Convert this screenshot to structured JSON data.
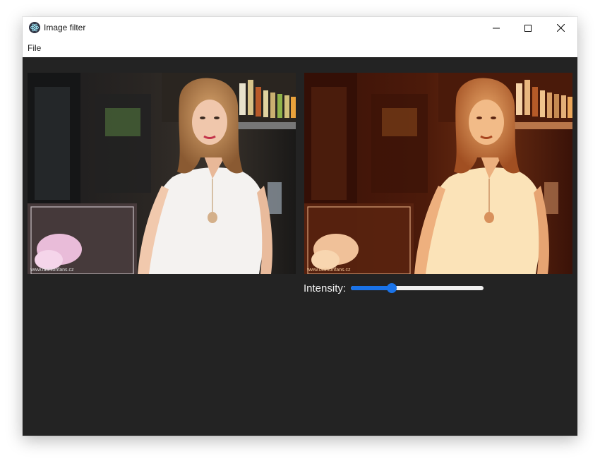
{
  "window": {
    "title": "Image filter"
  },
  "menubar": {
    "items": [
      {
        "label": "File"
      }
    ]
  },
  "images": {
    "original": {
      "watermark": "www.fashionfans.cz"
    },
    "filtered": {
      "watermark": "www.fashionfans.cz",
      "filter": "sepia"
    }
  },
  "controls": {
    "intensity_label": "Intensity:",
    "intensity_value": 0.31,
    "accent_color": "#1a73e8"
  },
  "icons": {
    "app": "electron-logo-icon",
    "minimize": "minimize-icon",
    "maximize": "maximize-icon",
    "close": "close-icon"
  }
}
